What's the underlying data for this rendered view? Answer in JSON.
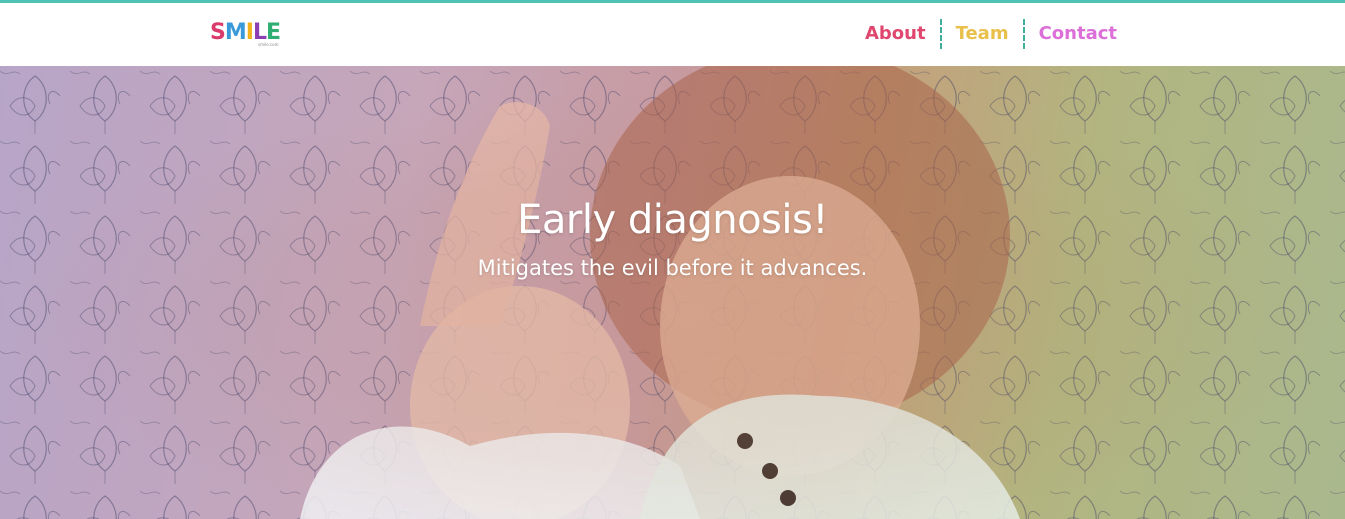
{
  "brand": {
    "logo_letters": [
      {
        "char": "S",
        "color": "#d93b6a"
      },
      {
        "char": "M",
        "color": "#3a9ad9"
      },
      {
        "char": "I",
        "color": "#f2b31b"
      },
      {
        "char": "L",
        "color": "#8b3fb3"
      },
      {
        "char": "E",
        "color": "#2fae74"
      }
    ],
    "logo_subtext": "smile.com"
  },
  "nav": {
    "items": [
      {
        "label": "About",
        "color": "#e0476f"
      },
      {
        "label": "Team",
        "color": "#e8c04a"
      },
      {
        "label": "Contact",
        "color": "#dc6fd8"
      }
    ],
    "separator_color": "#3fae9c"
  },
  "hero": {
    "title": "Early diagnosis!",
    "subtitle": "Mitigates the evil before it advances."
  },
  "colors": {
    "top_accent": "#4fc3b3"
  }
}
